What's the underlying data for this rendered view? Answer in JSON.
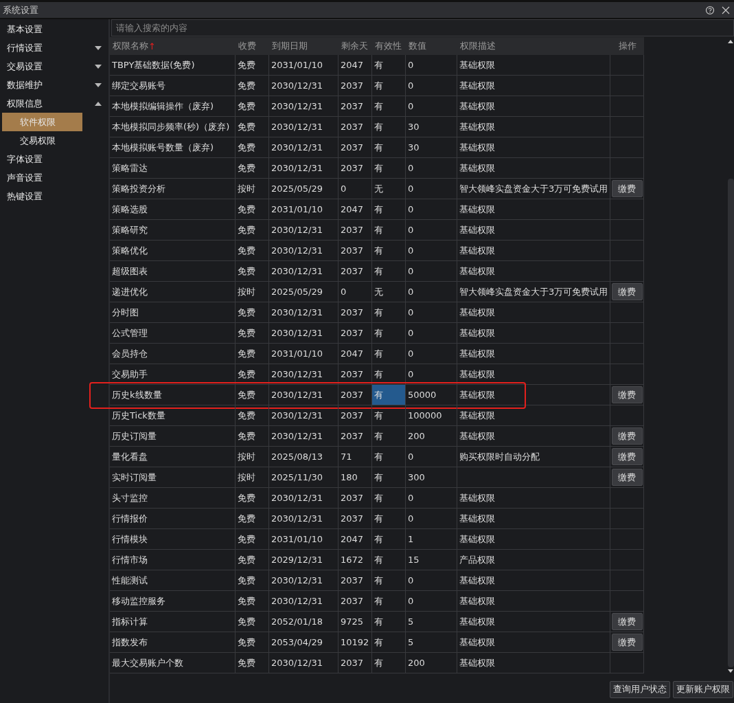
{
  "window": {
    "title": "系统设置"
  },
  "sidebar": {
    "items": [
      {
        "label": "基本设置",
        "selected": false
      },
      {
        "label": "行情设置",
        "selected": false,
        "expanded": false
      },
      {
        "label": "交易设置",
        "selected": false,
        "expanded": false
      },
      {
        "label": "数据维护",
        "selected": false,
        "expanded": false
      },
      {
        "label": "权限信息",
        "selected": false,
        "expanded": true,
        "children": [
          {
            "label": "软件权限",
            "selected": true
          },
          {
            "label": "交易权限",
            "selected": false
          }
        ]
      },
      {
        "label": "字体设置",
        "selected": false
      },
      {
        "label": "声音设置",
        "selected": false
      },
      {
        "label": "热键设置",
        "selected": false
      }
    ]
  },
  "search": {
    "placeholder": "请输入搜索的内容"
  },
  "table": {
    "columns": [
      {
        "label": "权限名称",
        "sort_mark": "↑"
      },
      {
        "label": "收费"
      },
      {
        "label": "到期日期"
      },
      {
        "label": "剩余天"
      },
      {
        "label": "有效性"
      },
      {
        "label": "数值"
      },
      {
        "label": "权限描述"
      },
      {
        "label": "操作"
      }
    ],
    "rows": [
      {
        "cells": [
          "TBPY基础数据(免费)",
          "免费",
          "2031/01/10",
          "2047",
          "有",
          "0",
          "基础权限"
        ],
        "selected": false
      },
      {
        "cells": [
          "绑定交易账号",
          "免费",
          "2030/12/31",
          "2037",
          "有",
          "0",
          "基础权限"
        ],
        "selected": false
      },
      {
        "cells": [
          "本地模拟编辑操作（废弃)",
          "免费",
          "2030/12/31",
          "2037",
          "有",
          "0",
          "基础权限"
        ],
        "selected": false
      },
      {
        "cells": [
          "本地模拟同步频率(秒)（废弃)",
          "免费",
          "2030/12/31",
          "2037",
          "有",
          "30",
          "基础权限"
        ],
        "selected": false
      },
      {
        "cells": [
          "本地模拟账号数量（废弃)",
          "免费",
          "2030/12/31",
          "2037",
          "有",
          "30",
          "基础权限"
        ],
        "selected": false
      },
      {
        "cells": [
          "策略雷达",
          "免费",
          "2030/12/31",
          "2037",
          "有",
          "0",
          "基础权限"
        ],
        "selected": false
      },
      {
        "cells": [
          "策略投资分析",
          "按时",
          "2025/05/29",
          "0",
          "无",
          "0",
          "智大领峰实盘资金大于3万可免费试用"
        ],
        "selected": false,
        "action": "缴费"
      },
      {
        "cells": [
          "策略选股",
          "免费",
          "2031/01/10",
          "2047",
          "有",
          "0",
          "基础权限"
        ],
        "selected": false
      },
      {
        "cells": [
          "策略研究",
          "免费",
          "2030/12/31",
          "2037",
          "有",
          "0",
          "基础权限"
        ],
        "selected": false
      },
      {
        "cells": [
          "策略优化",
          "免费",
          "2030/12/31",
          "2037",
          "有",
          "0",
          "基础权限"
        ],
        "selected": false
      },
      {
        "cells": [
          "超级图表",
          "免费",
          "2030/12/31",
          "2037",
          "有",
          "0",
          "基础权限"
        ],
        "selected": false
      },
      {
        "cells": [
          "递进优化",
          "按时",
          "2025/05/29",
          "0",
          "无",
          "0",
          "智大领峰实盘资金大于3万可免费试用"
        ],
        "selected": false,
        "action": "缴费"
      },
      {
        "cells": [
          "分时图",
          "免费",
          "2030/12/31",
          "2037",
          "有",
          "0",
          "基础权限"
        ],
        "selected": false
      },
      {
        "cells": [
          "公式管理",
          "免费",
          "2030/12/31",
          "2037",
          "有",
          "0",
          "基础权限"
        ],
        "selected": false
      },
      {
        "cells": [
          "会员持仓",
          "免费",
          "2031/01/10",
          "2047",
          "有",
          "0",
          "基础权限"
        ],
        "selected": false
      },
      {
        "cells": [
          "交易助手",
          "免费",
          "2030/12/31",
          "2037",
          "有",
          "0",
          "基础权限"
        ],
        "selected": false
      },
      {
        "cells": [
          "历史k线数量",
          "免费",
          "2030/12/31",
          "2037",
          "有",
          "50000",
          "基础权限"
        ],
        "selected": true,
        "annotated": true,
        "action": "缴费"
      },
      {
        "cells": [
          "历史Tick数量",
          "免费",
          "2030/12/31",
          "2037",
          "有",
          "100000",
          "基础权限"
        ],
        "selected": false
      },
      {
        "cells": [
          "历史订阅量",
          "免费",
          "2030/12/31",
          "2037",
          "有",
          "200",
          "基础权限"
        ],
        "selected": false,
        "action": "缴费"
      },
      {
        "cells": [
          "量化看盘",
          "按时",
          "2025/08/13",
          "71",
          "有",
          "0",
          "购买权限时自动分配"
        ],
        "selected": false,
        "action": "缴费"
      },
      {
        "cells": [
          "实时订阅量",
          "按时",
          "2025/11/30",
          "180",
          "有",
          "300",
          ""
        ],
        "selected": false,
        "action": "缴费"
      },
      {
        "cells": [
          "头寸监控",
          "免费",
          "2030/12/31",
          "2037",
          "有",
          "0",
          "基础权限"
        ],
        "selected": false
      },
      {
        "cells": [
          "行情报价",
          "免费",
          "2030/12/31",
          "2037",
          "有",
          "0",
          "基础权限"
        ],
        "selected": false
      },
      {
        "cells": [
          "行情模块",
          "免费",
          "2031/01/10",
          "2047",
          "有",
          "1",
          "基础权限"
        ],
        "selected": false
      },
      {
        "cells": [
          "行情市场",
          "免费",
          "2029/12/31",
          "1672",
          "有",
          "15",
          "产品权限"
        ],
        "selected": false
      },
      {
        "cells": [
          "性能测试",
          "免费",
          "2030/12/31",
          "2037",
          "有",
          "0",
          "基础权限"
        ],
        "selected": false
      },
      {
        "cells": [
          "移动监控服务",
          "免费",
          "2030/12/31",
          "2037",
          "有",
          "0",
          "基础权限"
        ],
        "selected": false
      },
      {
        "cells": [
          "指标计算",
          "免费",
          "2052/01/18",
          "9725",
          "有",
          "5",
          "基础权限"
        ],
        "selected": false,
        "action": "缴费"
      },
      {
        "cells": [
          "指数发布",
          "免费",
          "2053/04/29",
          "10192",
          "有",
          "5",
          "基础权限"
        ],
        "selected": false,
        "action": "缴费"
      },
      {
        "cells": [
          "最大交易账户个数",
          "免费",
          "2030/12/31",
          "2037",
          "有",
          "200",
          "基础权限"
        ],
        "selected": false
      }
    ]
  },
  "buttons": [
    "查询用户状态",
    "更新账户权限"
  ]
}
